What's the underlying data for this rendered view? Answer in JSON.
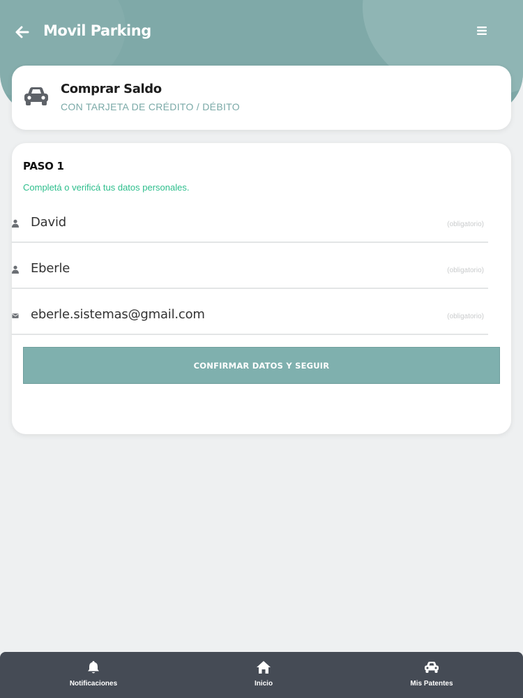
{
  "header": {
    "title": "Movil Parking",
    "back_icon": "arrow-left-icon",
    "menu_icon": "hamburger-menu-icon"
  },
  "top_card": {
    "icon": "car-icon",
    "title": "Comprar Saldo",
    "subtitle": "CON TARJETA DE CRÉDITO / DÉBITO"
  },
  "form": {
    "step_title": "PASO 1",
    "step_description": "Completá o verificá tus datos personales.",
    "fields": [
      {
        "icon": "user-icon",
        "value": "David",
        "required_hint": "(obligatorio)"
      },
      {
        "icon": "user-icon",
        "value": "Eberle",
        "required_hint": "(obligatorio)"
      },
      {
        "icon": "envelope-icon",
        "value": "eberle.sistemas@gmail.com",
        "required_hint": "(obligatorio)"
      }
    ],
    "confirm_button": "CONFIRMAR DATOS Y SEGUIR"
  },
  "bottom_nav": {
    "items": [
      {
        "icon": "bell-icon",
        "label": "Notificaciones"
      },
      {
        "icon": "home-icon",
        "label": "Inicio"
      },
      {
        "icon": "car-icon",
        "label": "Mis Patentes"
      }
    ]
  },
  "colors": {
    "header_bg": "#7fa9a8",
    "accent_teal": "#7fb0ae",
    "subtitle_teal": "#7aa9a7",
    "success_green": "#2dbe8c",
    "nav_bg": "#454b55",
    "page_bg": "#eef0f1"
  }
}
